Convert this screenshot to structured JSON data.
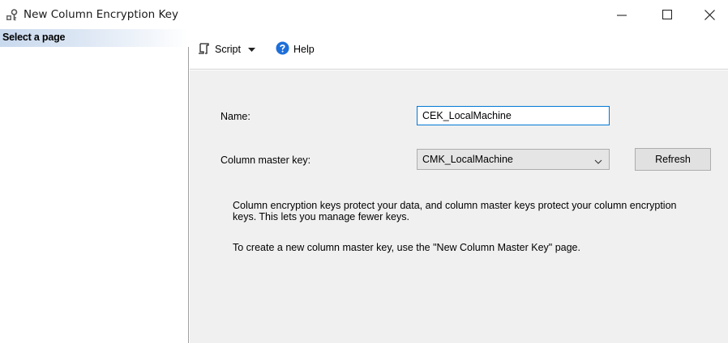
{
  "window": {
    "title": "New Column Encryption Key",
    "icon": "key-icon",
    "controls": [
      "minimize-icon",
      "maximize-icon",
      "close-icon"
    ]
  },
  "left_pane": {
    "header": "Select a page"
  },
  "toolbar": {
    "script_label": "Script",
    "script_icon": "script-icon",
    "dropdown_icon": "dropdown-arrow-icon",
    "help_label": "Help",
    "help_icon": "help-icon",
    "help_icon_color": "#1e6fd9"
  },
  "form": {
    "name_label": "Name:",
    "name_value": "CEK_LocalMachine",
    "cmk_label": "Column master key:",
    "cmk_value": "CMK_LocalMachine",
    "refresh_label": "Refresh",
    "info_line_1": "Column encryption keys protect your data, and column master keys protect your column encryption keys. This lets you manage fewer keys.",
    "info_line_2": "To create a new column master key, use the \"New Column Master Key\" page."
  },
  "colors": {
    "accent_focus_border": "#0078d7",
    "content_background": "#f0f0f0"
  }
}
